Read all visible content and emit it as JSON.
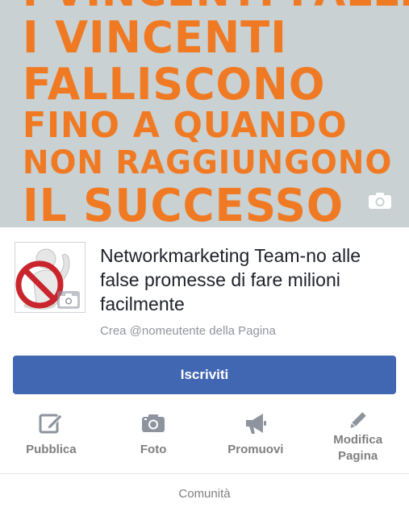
{
  "cover": {
    "lines": [
      "I VINCENTI FALLISCONO",
      "I VINCENTI",
      "FALLISCONO",
      "FINO A QUANDO",
      "NON RAGGIUNGONO",
      "IL SUCCESSO"
    ],
    "text_color": "#f07a23",
    "background_color": "#c9d1d3",
    "camera_icon": "camera-icon"
  },
  "profile": {
    "title": "Networkmarketing Team-no alle false promesse di fare milioni facilmente",
    "username_prompt": "Crea @nomeutente della Pagina",
    "avatar_camera_icon": "camera-icon"
  },
  "subscribe_button": {
    "label": "Iscriviti",
    "color": "#4267b2"
  },
  "actions": [
    {
      "label": "Pubblica",
      "icon": "edit-icon"
    },
    {
      "label": "Foto",
      "icon": "camera-icon"
    },
    {
      "label": "Promuovi",
      "icon": "megaphone-icon"
    },
    {
      "label": "Modifica Pagina",
      "icon": "pencil-icon"
    }
  ],
  "tabs": {
    "community": "Comunità"
  }
}
